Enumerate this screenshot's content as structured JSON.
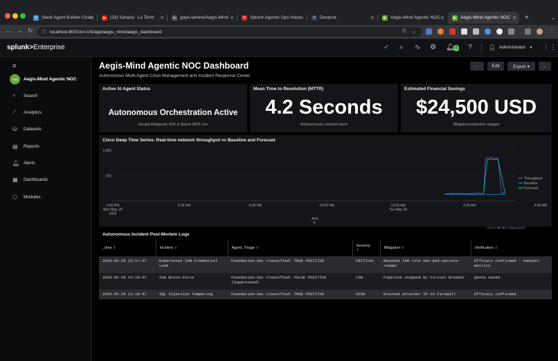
{
  "browser": {
    "tabs": [
      {
        "label": "Slack Agent Builder Chall",
        "fav_color": "#4a90d9",
        "fav": "✦"
      },
      {
        "label": "(33) Sahara : Le Territ",
        "fav_color": "#e62117",
        "fav": "▶"
      },
      {
        "label": "gaye-lamine/Aegis-Mind",
        "fav_color": "#333333",
        "fav": "●"
      },
      {
        "label": "Splunk Agentic Ops Hack",
        "fav_color": "#c5221f",
        "fav": "M"
      },
      {
        "label": "Devpost",
        "fav_color": "#2d3a4a",
        "fav": "D"
      },
      {
        "label": "Aegis-Mind Agentic NOC",
        "fav_color": "#65a637",
        "fav": "▶"
      },
      {
        "label": "Aegis-Mind Agentic NOC",
        "fav_color": "#65a637",
        "fav": "▶"
      }
    ],
    "url": "localhost:8001/en-US/app/aegis_mind/aegis_dashboard"
  },
  "splunk": {
    "logo_bold": "splunk>",
    "logo_rest": "Enterprise",
    "notif_count": "1",
    "user": "Administrator"
  },
  "sidebar": {
    "app_icon": "App",
    "app_name": "Aegis-Mind Agentic NOC",
    "items": [
      {
        "label": "Search",
        "icon": "search-icon"
      },
      {
        "label": "Analytics",
        "icon": "analytics-icon"
      },
      {
        "label": "Datasets",
        "icon": "datasets-icon"
      },
      {
        "label": "Reports",
        "icon": "reports-icon"
      },
      {
        "label": "Alerts",
        "icon": "alerts-icon"
      },
      {
        "label": "Dashboards",
        "icon": "dashboards-icon"
      },
      {
        "label": "Modules",
        "icon": "modules-icon"
      }
    ]
  },
  "dashboard": {
    "title": "Aegis-Mind Agentic NOC Dashboard",
    "subtitle": "Autonomous Multi-Agent Crisis Management and Incident Response Center",
    "edit_label": "Edit",
    "export_label": "Export ▾",
    "more_label": "..."
  },
  "panels": {
    "status": {
      "title": "Active AI Agent Status",
      "value": "Autonomous Orchestration Active",
      "caption": "Google Antigravity SDK & Splunk MCP Live"
    },
    "mttr": {
      "title": "Mean Time to Resolution (MTTR)",
      "value": "4.2 Seconds",
      "caption": "Autonomously resolved alerts"
    },
    "savings": {
      "title": "Estimated Financial Savings",
      "value": "$24,500 USD",
      "caption": "Mitigated production outages"
    }
  },
  "chart_panel": {
    "title": "Cisco Deep Time Series: Real-time network throughput vs Baseline and Forecast",
    "age": "<1m ago"
  },
  "chart_data": {
    "type": "line",
    "xlabel": "_time",
    "ylabel": "",
    "ylim": [
      0,
      1000
    ],
    "y_ticks": [
      "1,000",
      "500"
    ],
    "x_ticks": [
      {
        "label": "4:00 PM",
        "sub1": "Mon May 25",
        "sub2": "2026"
      },
      {
        "label": "6:00 PM"
      },
      {
        "label": "8:00 PM"
      },
      {
        "label": "10:00 PM"
      },
      {
        "label": "12:00 AM",
        "sub1": "Tue May 26"
      },
      {
        "label": "2:00 AM"
      },
      {
        "label": "4:00 AM"
      },
      {
        "label": "6:00 AM"
      },
      {
        "label": "8:00 AM"
      },
      {
        "label": "10:00 AM"
      },
      {
        "label": "12:00 PM"
      },
      {
        "label": "2:00 PM"
      }
    ],
    "legend": "right",
    "series": [
      {
        "name": "Throughput",
        "color": "#7b56db",
        "x": [
          12.8,
          13.0,
          13.2,
          13.3,
          13.4,
          13.6,
          13.7,
          13.75,
          13.8,
          13.85,
          13.9,
          13.95,
          14.0,
          14.05,
          14.1,
          14.2,
          14.3,
          14.4,
          14.5
        ],
        "y": [
          140,
          150,
          145,
          150,
          140,
          150,
          145,
          160,
          150,
          145,
          155,
          830,
          860,
          840,
          870,
          830,
          850,
          160,
          150
        ]
      },
      {
        "name": "Baseline",
        "color": "#009ceb",
        "x": [
          12.8,
          13.2,
          13.6,
          14.0,
          14.4,
          14.5
        ],
        "y": [
          130,
          130,
          130,
          130,
          130,
          130
        ]
      },
      {
        "name": "Forecast",
        "color": "#00cdaf",
        "x": [
          13.9,
          14.0,
          14.3,
          14.5
        ],
        "y": [
          160,
          820,
          820,
          160
        ]
      }
    ]
  },
  "table": {
    "title": "Autonomous Incident Post-Mortem Logs",
    "columns": [
      "_time",
      "Incident",
      "Agent_Triage",
      "Severity",
      "Mitigation",
      "Verification"
    ],
    "rows": [
      {
        "time": "2026-05-26 15:17:47",
        "incident": "Kubernetes IAM Credential Leak",
        "triage": "Foundation-Sec classified: TRUE POSITIVE",
        "severity": "CRITICAL",
        "mitigation": "Revoked IAM role k8s-pod-secrets-reader",
        "verification": "Efficacy confirmed - nominal metrics"
      },
      {
        "time": "2026-05-26 14:18:47",
        "incident": "SSH Brute-Force",
        "triage": "Foundation-Sec classified: FALSE POSITIVE (Suppressed)",
        "severity": "LOW",
        "mitigation": "Pipeline stopped by Circuit Breaker",
        "verification": "Quota saved"
      },
      {
        "time": "2026-05-26 13:18:47",
        "incident": "SQL Injection Tampering",
        "triage": "Foundation-Sec classified: TRUE POSITIVE",
        "severity": "HIGH",
        "mitigation": "Blocked attacker IP on Firewall",
        "verification": "Efficacy confirmed"
      }
    ]
  }
}
